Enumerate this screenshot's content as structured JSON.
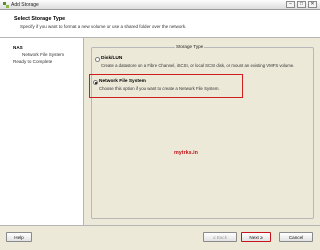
{
  "window": {
    "title": "Add Storage",
    "minimize_glyph": "–",
    "maximize_glyph": "□",
    "close_glyph": "✕"
  },
  "header": {
    "title": "Select Storage Type",
    "subtitle": "Specify if you want to format a new volume or use a shared folder over the network."
  },
  "steps": [
    {
      "label": "NAS",
      "current": true
    },
    {
      "label": "Network File System",
      "current": false
    },
    {
      "label": "Ready to Complete",
      "current": false
    }
  ],
  "storage_type": {
    "group_label": "Storage Type",
    "options": [
      {
        "title": "Disk/LUN",
        "description": "Create a datastore on a Fibre Channel, iSCSI, or local SCSI disk, or mount an existing VMFS volume.",
        "selected": false
      },
      {
        "title": "Network File System",
        "description": "Choose this option if you want to create a Network File System.",
        "selected": true
      }
    ]
  },
  "watermark": "mytrks.in",
  "footer": {
    "help": "Help",
    "back": "≤ Back",
    "next": "Next ≥",
    "cancel": "Cancel"
  },
  "colors": {
    "highlight": "#d01c1c",
    "watermark": "#c4161c"
  }
}
